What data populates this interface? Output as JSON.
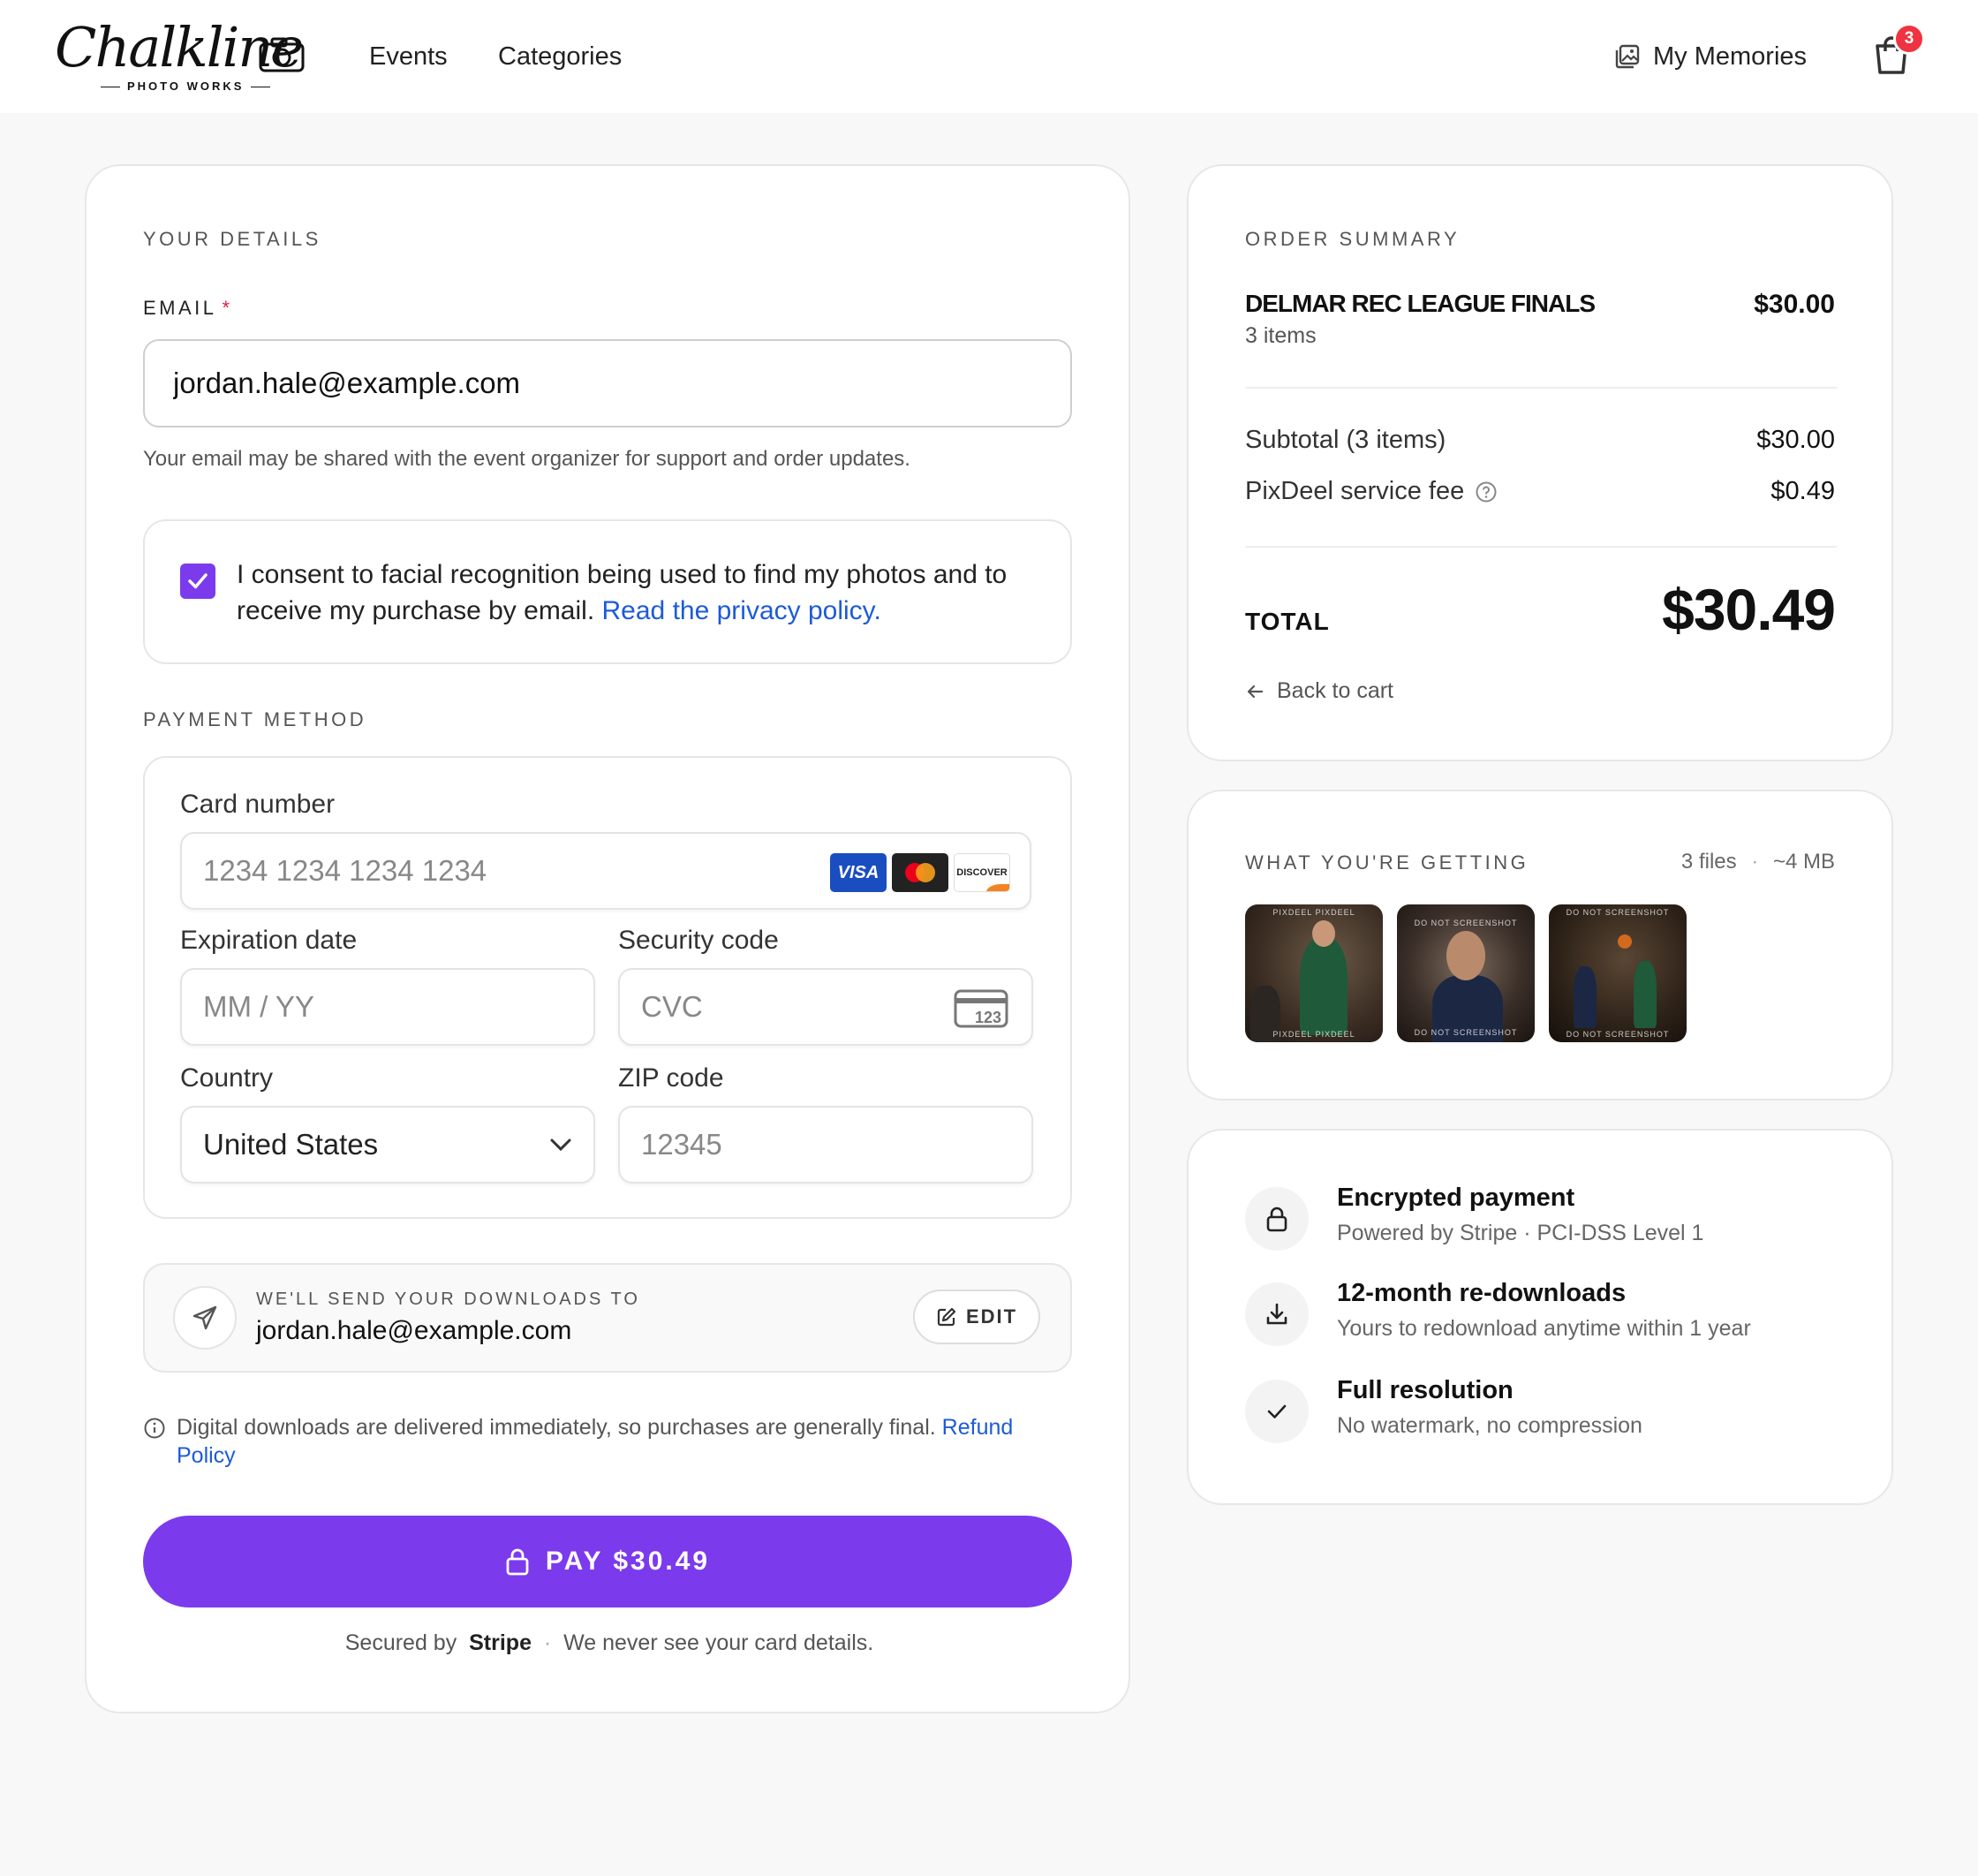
{
  "header": {
    "logo_script": "Chalkline",
    "logo_sub": "PHOTO WORKS",
    "nav": {
      "events": "Events",
      "categories": "Categories"
    },
    "my_memories": "My Memories",
    "cart_count": "3"
  },
  "details": {
    "section_label": "YOUR DETAILS",
    "email_label": "EMAIL",
    "email_required_mark": "*",
    "email_value": "jordan.hale@example.com",
    "email_help": "Your email may be shared with the event organizer for support and order updates.",
    "consent_checked": true,
    "consent_text": "I consent to facial recognition being used to find my photos and to receive my purchase by email.",
    "consent_link": "Read the privacy policy."
  },
  "payment": {
    "section_label": "PAYMENT METHOD",
    "card_number_label": "Card number",
    "card_number_placeholder": "1234 1234 1234 1234",
    "brands": [
      "VISA",
      "Mastercard",
      "DISCOVER"
    ],
    "expiry_label": "Expiration date",
    "expiry_placeholder": "MM / YY",
    "cvc_label": "Security code",
    "cvc_placeholder": "CVC",
    "cvc_icon_text": "123",
    "country_label": "Country",
    "country_value": "United States",
    "zip_label": "ZIP code",
    "zip_placeholder": "12345"
  },
  "send_to": {
    "label": "WE'LL SEND YOUR DOWNLOADS TO",
    "email": "jordan.hale@example.com",
    "edit_label": "EDIT"
  },
  "refund": {
    "text": "Digital downloads are delivered immediately, so purchases are generally final.",
    "link": "Refund Policy"
  },
  "pay_button": "PAY $30.49",
  "secured": {
    "prefix": "Secured by",
    "brand": "Stripe",
    "sep": "·",
    "suffix": "We never see your card details."
  },
  "summary": {
    "section_label": "ORDER SUMMARY",
    "event_name": "DELMAR REC LEAGUE FINALS",
    "event_price": "$30.00",
    "event_items": "3 items",
    "subtotal_label": "Subtotal (3 items)",
    "subtotal_value": "$30.00",
    "fee_label": "PixDeel service fee",
    "fee_value": "$0.49",
    "total_label": "TOTAL",
    "total_value": "$30.49",
    "back_label": "Back to cart"
  },
  "getting": {
    "section_label": "WHAT YOU'RE GETTING",
    "files": "3 files",
    "sep": "·",
    "size": "~4 MB",
    "thumbs": [
      {
        "wm_top": "PIXDEEL   PIXDEEL",
        "wm_bottom": "PIXDEEL   PIXDEEL"
      },
      {
        "wm_top": "DO NOT SCREENSHOT",
        "wm_bottom": "DO NOT SCREENSHOT"
      },
      {
        "wm_top": "DO NOT SCREENSHOT",
        "wm_bottom": "DO NOT SCREENSHOT"
      }
    ]
  },
  "trust": [
    {
      "title": "Encrypted payment",
      "sub": "Powered by Stripe · PCI-DSS Level 1",
      "icon": "lock-icon"
    },
    {
      "title": "12-month re-downloads",
      "sub": "Yours to redownload anytime within 1 year",
      "icon": "download-icon"
    },
    {
      "title": "Full resolution",
      "sub": "No watermark, no compression",
      "icon": "check-icon"
    }
  ],
  "colors": {
    "accent": "#7c3aed",
    "link": "#1d5bd8",
    "badge": "#ef3340"
  }
}
